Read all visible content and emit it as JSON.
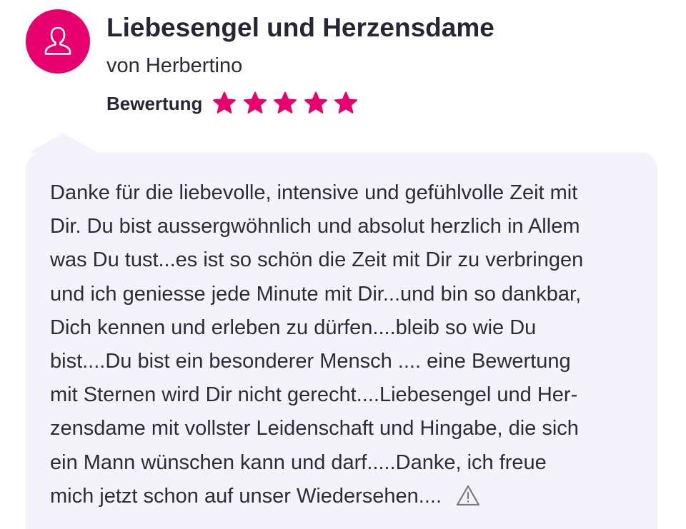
{
  "review": {
    "title": "Liebesengel und Herzensdame",
    "author": "von Herbertino",
    "rating_label": "Bewertung",
    "rating": 5,
    "rating_max": 5,
    "text_lines": [
      "Danke für die liebevolle, intensive und gefühlvolle Zeit mit",
      "Dir. Du bist aussergwöhnlich und absolut herzlich in Allem",
      "was Du tust...es ist so schön die Zeit mit Dir zu verbringen",
      "und ich geniesse jede Minute mit Dir...und bin so dankbar,",
      "Dich kennen und erleben zu dürfen....bleib so wie Du",
      "bist....Du bist ein besonderer Mensch .... eine Bewertung",
      "mit Sternen wird Dir nicht gerecht....Liebesengel und Her-",
      "zensdame mit vollster Leidenschaft und Hingabe, die sich",
      "ein Mann wünschen kann und darf.....Danke, ich freue",
      "mich jetzt schon auf unser Wiedersehen...."
    ]
  },
  "icons": {
    "avatar": "user-icon",
    "star": "star-icon",
    "report": "warning-triangle-icon"
  },
  "colors": {
    "accent": "#e6006e",
    "bubble_background": "#f4f3fc",
    "text": "#2b2b3a",
    "report_icon": "#7a7a86"
  }
}
